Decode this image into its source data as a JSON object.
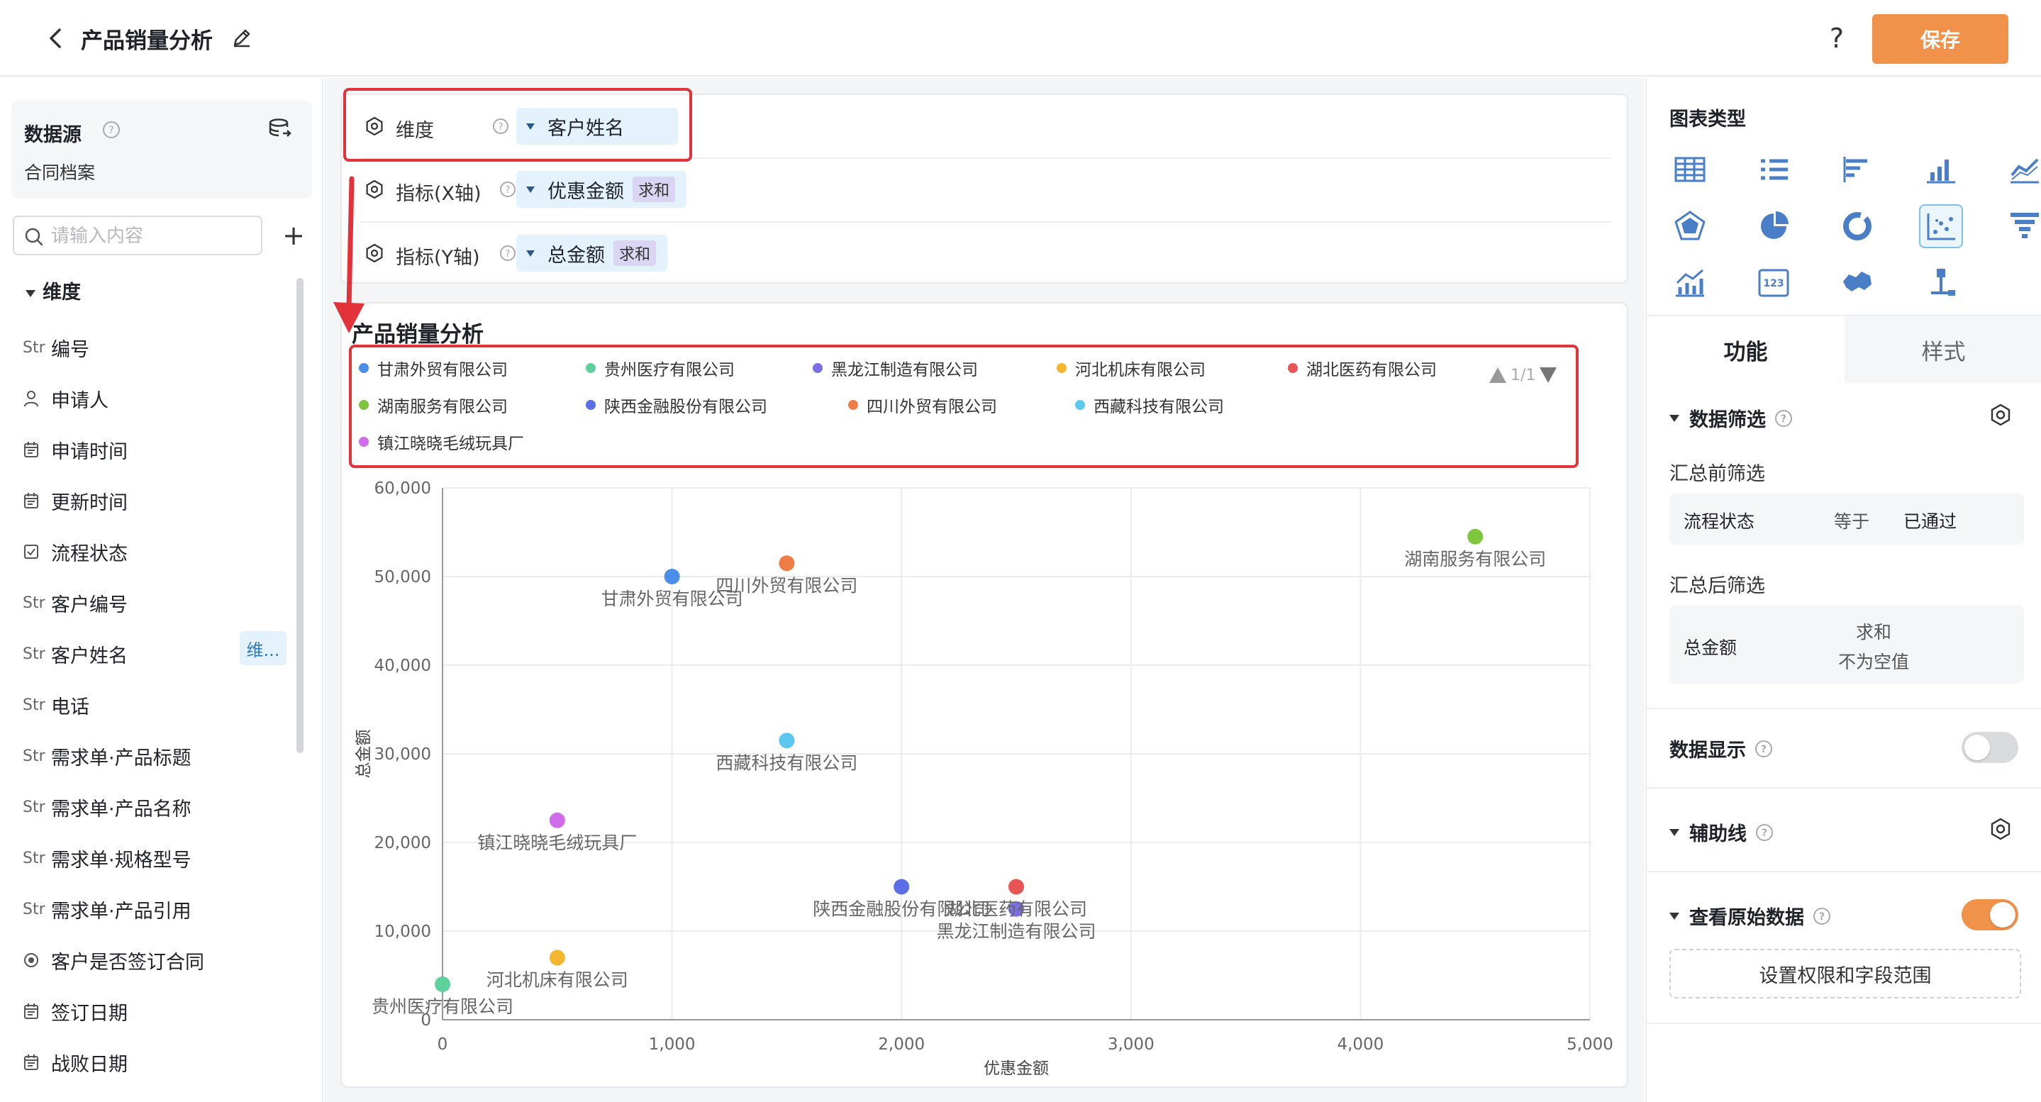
{
  "header": {
    "title": "产品销量分析",
    "help": "?",
    "save_label": "保存"
  },
  "sidebar": {
    "datasource_title": "数据源",
    "datasource_name": "合同档案",
    "search_placeholder": "请输入内容",
    "add": "+",
    "dimension_header": "维度",
    "dimension_badge": "维...",
    "fields": [
      {
        "type": "Str",
        "label": "编号"
      },
      {
        "type": "user-icon",
        "label": "申请人"
      },
      {
        "type": "calendar-icon",
        "label": "申请时间"
      },
      {
        "type": "calendar-icon",
        "label": "更新时间"
      },
      {
        "type": "checkbox-icon",
        "label": "流程状态"
      },
      {
        "type": "Str",
        "label": "客户编号"
      },
      {
        "type": "Str",
        "label": "客户姓名"
      },
      {
        "type": "Str",
        "label": "电话"
      },
      {
        "type": "Str",
        "label": "需求单·产品标题"
      },
      {
        "type": "Str",
        "label": "需求单·产品名称"
      },
      {
        "type": "Str",
        "label": "需求单·规格型号"
      },
      {
        "type": "Str",
        "label": "需求单·产品引用"
      },
      {
        "type": "radio-icon",
        "label": "客户是否签订合同"
      },
      {
        "type": "calendar-icon",
        "label": "签订日期"
      },
      {
        "type": "calendar-icon",
        "label": "战败日期"
      }
    ]
  },
  "config": {
    "dimension": {
      "label": "维度",
      "value": "客户姓名"
    },
    "x_metric": {
      "label": "指标(X轴)",
      "value": "优惠金额",
      "agg": "求和"
    },
    "y_metric": {
      "label": "指标(Y轴)",
      "value": "总金额",
      "agg": "求和"
    }
  },
  "legend_pager": "1/1",
  "chart_data": {
    "type": "scatter",
    "title": "产品销量分析",
    "xlabel": "优惠金额",
    "ylabel": "总金额",
    "xlim": [
      0,
      5000
    ],
    "ylim": [
      0,
      60000
    ],
    "x_ticks": [
      "0",
      "1,000",
      "2,000",
      "3,000",
      "4,000",
      "5,000"
    ],
    "y_ticks": [
      "0",
      "10,000",
      "20,000",
      "30,000",
      "40,000",
      "50,000",
      "60,000"
    ],
    "grid": true,
    "legend_placement": "top",
    "series": [
      {
        "name": "甘肃外贸有限公司",
        "color": "#4a8ee8",
        "x": 1000,
        "y": 50000
      },
      {
        "name": "贵州医疗有限公司",
        "color": "#5fd19c",
        "x": 0,
        "y": 4000
      },
      {
        "name": "黑龙江制造有限公司",
        "color": "#7b6fe3",
        "x": 2500,
        "y": 12500
      },
      {
        "name": "河北机床有限公司",
        "color": "#f2b630",
        "x": 500,
        "y": 7000
      },
      {
        "name": "湖北医药有限公司",
        "color": "#e85555",
        "x": 2500,
        "y": 15000
      },
      {
        "name": "湖南服务有限公司",
        "color": "#7ec63e",
        "x": 4500,
        "y": 54500
      },
      {
        "name": "陕西金融股份有限公司",
        "color": "#5b6ee8",
        "x": 2000,
        "y": 15000
      },
      {
        "name": "四川外贸有限公司",
        "color": "#ee7c45",
        "x": 1500,
        "y": 51500
      },
      {
        "name": "西藏科技有限公司",
        "color": "#5cc8f0",
        "x": 1500,
        "y": 31500
      },
      {
        "name": "镇江晓晓毛绒玩具厂",
        "color": "#cf6cea",
        "x": 500,
        "y": 22500
      }
    ]
  },
  "right": {
    "chart_type_title": "图表类型",
    "tab_function": "功能",
    "tab_style": "样式",
    "data_filter": "数据筛选",
    "pre_filter": "汇总前筛选",
    "pre_filter_row": {
      "field": "流程状态",
      "op": "等于",
      "value": "已通过"
    },
    "post_filter": "汇总后筛选",
    "post_filter_row": {
      "field": "总金额",
      "agg": "求和",
      "cond": "不为空值"
    },
    "data_display": "数据显示",
    "aux_line": "辅助线",
    "view_raw": "查看原始数据",
    "perm_button": "设置权限和字段范围"
  },
  "colors": {
    "accent": "#f0924a",
    "highlight_box": "#e2333b",
    "pill_bg": "#e4f2fb"
  }
}
